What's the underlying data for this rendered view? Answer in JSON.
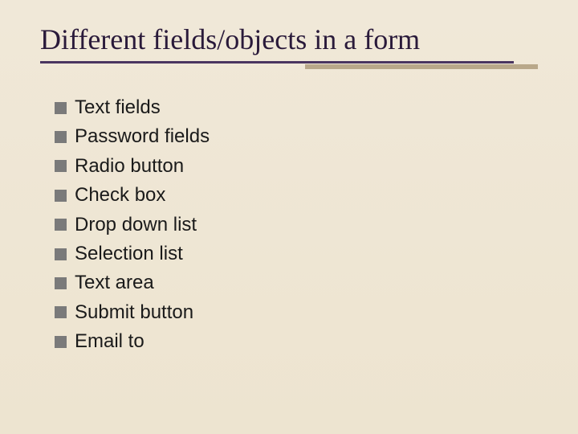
{
  "slide": {
    "title": "Different fields/objects in a form",
    "items": [
      "Text fields",
      "Password fields",
      "Radio button",
      "Check box",
      "Drop down list",
      "Selection list",
      "Text area",
      "Submit button",
      "Email to"
    ]
  }
}
